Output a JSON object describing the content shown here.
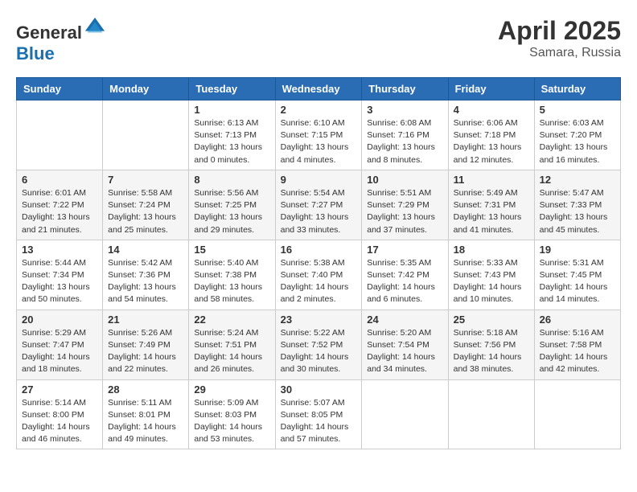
{
  "header": {
    "logo_general": "General",
    "logo_blue": "Blue",
    "month_year": "April 2025",
    "location": "Samara, Russia"
  },
  "weekdays": [
    "Sunday",
    "Monday",
    "Tuesday",
    "Wednesday",
    "Thursday",
    "Friday",
    "Saturday"
  ],
  "weeks": [
    [
      {
        "day": "",
        "info": ""
      },
      {
        "day": "",
        "info": ""
      },
      {
        "day": "1",
        "info": "Sunrise: 6:13 AM\nSunset: 7:13 PM\nDaylight: 13 hours and 0 minutes."
      },
      {
        "day": "2",
        "info": "Sunrise: 6:10 AM\nSunset: 7:15 PM\nDaylight: 13 hours and 4 minutes."
      },
      {
        "day": "3",
        "info": "Sunrise: 6:08 AM\nSunset: 7:16 PM\nDaylight: 13 hours and 8 minutes."
      },
      {
        "day": "4",
        "info": "Sunrise: 6:06 AM\nSunset: 7:18 PM\nDaylight: 13 hours and 12 minutes."
      },
      {
        "day": "5",
        "info": "Sunrise: 6:03 AM\nSunset: 7:20 PM\nDaylight: 13 hours and 16 minutes."
      }
    ],
    [
      {
        "day": "6",
        "info": "Sunrise: 6:01 AM\nSunset: 7:22 PM\nDaylight: 13 hours and 21 minutes."
      },
      {
        "day": "7",
        "info": "Sunrise: 5:58 AM\nSunset: 7:24 PM\nDaylight: 13 hours and 25 minutes."
      },
      {
        "day": "8",
        "info": "Sunrise: 5:56 AM\nSunset: 7:25 PM\nDaylight: 13 hours and 29 minutes."
      },
      {
        "day": "9",
        "info": "Sunrise: 5:54 AM\nSunset: 7:27 PM\nDaylight: 13 hours and 33 minutes."
      },
      {
        "day": "10",
        "info": "Sunrise: 5:51 AM\nSunset: 7:29 PM\nDaylight: 13 hours and 37 minutes."
      },
      {
        "day": "11",
        "info": "Sunrise: 5:49 AM\nSunset: 7:31 PM\nDaylight: 13 hours and 41 minutes."
      },
      {
        "day": "12",
        "info": "Sunrise: 5:47 AM\nSunset: 7:33 PM\nDaylight: 13 hours and 45 minutes."
      }
    ],
    [
      {
        "day": "13",
        "info": "Sunrise: 5:44 AM\nSunset: 7:34 PM\nDaylight: 13 hours and 50 minutes."
      },
      {
        "day": "14",
        "info": "Sunrise: 5:42 AM\nSunset: 7:36 PM\nDaylight: 13 hours and 54 minutes."
      },
      {
        "day": "15",
        "info": "Sunrise: 5:40 AM\nSunset: 7:38 PM\nDaylight: 13 hours and 58 minutes."
      },
      {
        "day": "16",
        "info": "Sunrise: 5:38 AM\nSunset: 7:40 PM\nDaylight: 14 hours and 2 minutes."
      },
      {
        "day": "17",
        "info": "Sunrise: 5:35 AM\nSunset: 7:42 PM\nDaylight: 14 hours and 6 minutes."
      },
      {
        "day": "18",
        "info": "Sunrise: 5:33 AM\nSunset: 7:43 PM\nDaylight: 14 hours and 10 minutes."
      },
      {
        "day": "19",
        "info": "Sunrise: 5:31 AM\nSunset: 7:45 PM\nDaylight: 14 hours and 14 minutes."
      }
    ],
    [
      {
        "day": "20",
        "info": "Sunrise: 5:29 AM\nSunset: 7:47 PM\nDaylight: 14 hours and 18 minutes."
      },
      {
        "day": "21",
        "info": "Sunrise: 5:26 AM\nSunset: 7:49 PM\nDaylight: 14 hours and 22 minutes."
      },
      {
        "day": "22",
        "info": "Sunrise: 5:24 AM\nSunset: 7:51 PM\nDaylight: 14 hours and 26 minutes."
      },
      {
        "day": "23",
        "info": "Sunrise: 5:22 AM\nSunset: 7:52 PM\nDaylight: 14 hours and 30 minutes."
      },
      {
        "day": "24",
        "info": "Sunrise: 5:20 AM\nSunset: 7:54 PM\nDaylight: 14 hours and 34 minutes."
      },
      {
        "day": "25",
        "info": "Sunrise: 5:18 AM\nSunset: 7:56 PM\nDaylight: 14 hours and 38 minutes."
      },
      {
        "day": "26",
        "info": "Sunrise: 5:16 AM\nSunset: 7:58 PM\nDaylight: 14 hours and 42 minutes."
      }
    ],
    [
      {
        "day": "27",
        "info": "Sunrise: 5:14 AM\nSunset: 8:00 PM\nDaylight: 14 hours and 46 minutes."
      },
      {
        "day": "28",
        "info": "Sunrise: 5:11 AM\nSunset: 8:01 PM\nDaylight: 14 hours and 49 minutes."
      },
      {
        "day": "29",
        "info": "Sunrise: 5:09 AM\nSunset: 8:03 PM\nDaylight: 14 hours and 53 minutes."
      },
      {
        "day": "30",
        "info": "Sunrise: 5:07 AM\nSunset: 8:05 PM\nDaylight: 14 hours and 57 minutes."
      },
      {
        "day": "",
        "info": ""
      },
      {
        "day": "",
        "info": ""
      },
      {
        "day": "",
        "info": ""
      }
    ]
  ]
}
